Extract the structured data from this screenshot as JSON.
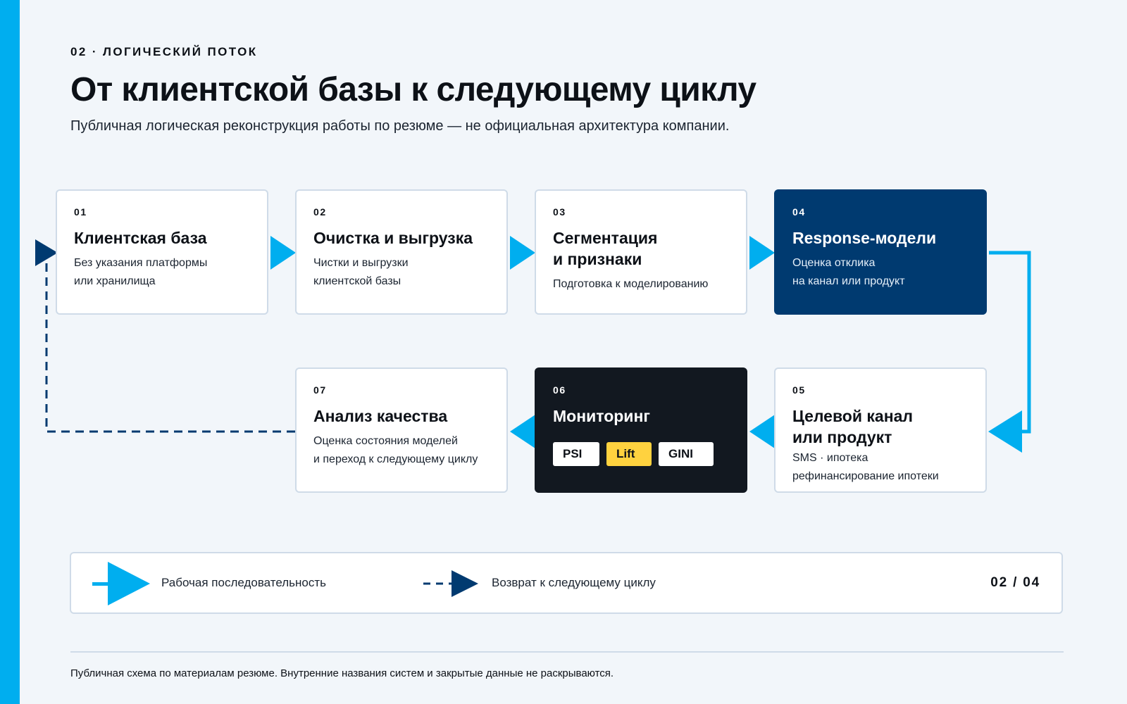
{
  "header": {
    "eyebrow": "02 · ЛОГИЧЕСКИЙ ПОТОК",
    "title": "От клиентской базы к следующему циклу",
    "subtitle": "Публичная логическая реконструкция работы по резюме — не официальная архитектура компании."
  },
  "steps": [
    {
      "num": "01",
      "title": "Клиентская база",
      "desc": "Без указания платформы\nили хранилища"
    },
    {
      "num": "02",
      "title": "Очистка и выгрузка",
      "desc": "Чистки и выгрузки\nклиентской базы"
    },
    {
      "num": "03",
      "title": "Сегментация\nи признаки",
      "desc": "Подготовка к моделированию"
    },
    {
      "num": "04",
      "title": "Response-модели",
      "desc": "Оценка отклика\nна канал или продукт"
    },
    {
      "num": "05",
      "title": "Целевой канал\nили продукт",
      "desc": "SMS · ипотека\nрефинансирование ипотеки"
    },
    {
      "num": "06",
      "title": "Мониторинг",
      "chips": [
        "PSI",
        "Lift",
        "GINI"
      ]
    },
    {
      "num": "07",
      "title": "Анализ качества",
      "desc": "Оценка состояния моделей\nи переход к следующему циклу"
    }
  ],
  "legend": {
    "solid_label": "Рабочая последовательность",
    "dashed_label": "Возврат к следующему циклу",
    "page": "02 / 04"
  },
  "footer": {
    "note": "Публичная схема по материалам резюме. Внутренние названия систем и закрытые данные не раскрываются."
  },
  "colors": {
    "accent": "#00aeef",
    "navy": "#003a70",
    "dark": "#121820",
    "highlight": "#ffd23f",
    "background": "#f2f6fa",
    "border": "#cfdbe8"
  }
}
